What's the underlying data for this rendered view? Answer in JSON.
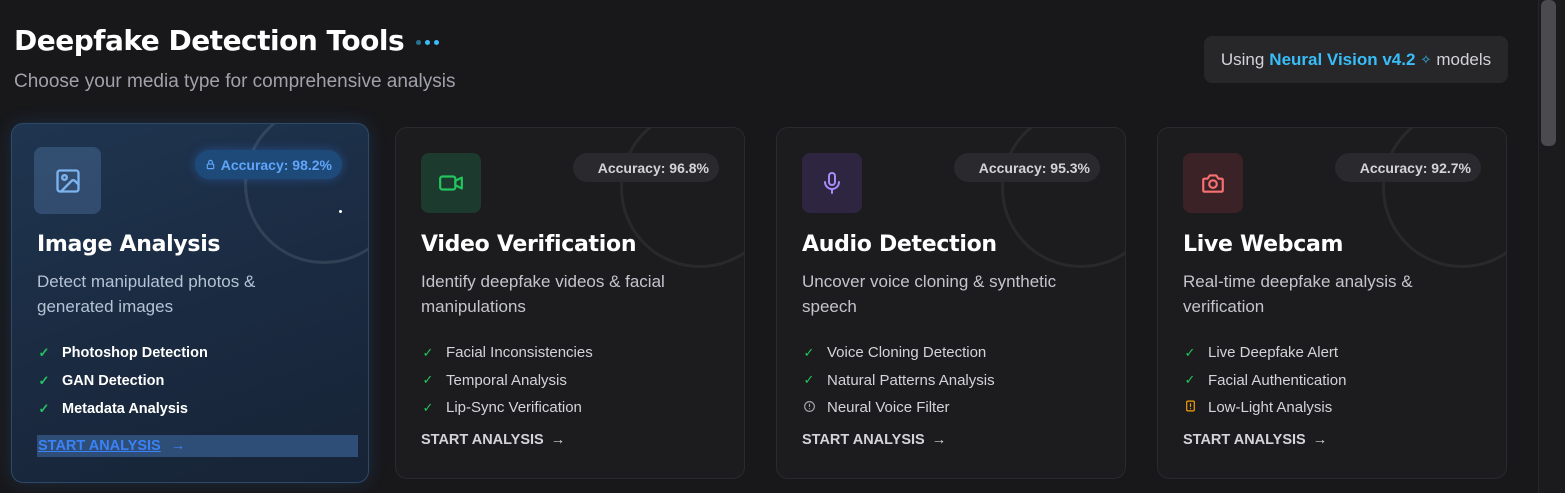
{
  "header": {
    "title": "Deepfake Detection Tools",
    "subtitle": "Choose your media type for comprehensive analysis"
  },
  "model_pill": {
    "prefix": "Using",
    "model_name": "Neural Vision v4.2",
    "suffix": "models",
    "sparkle_icon": "sparkle-icon"
  },
  "colors": {
    "accent": "#38bdf8",
    "success": "#22c55e",
    "warning": "#f59e0b",
    "active_card": "#1f3550"
  },
  "cards": [
    {
      "title": "Image Analysis",
      "description": "Detect manipulated photos & generated images",
      "accuracy": "Accuracy: 98.2%",
      "icon": "image-icon",
      "features": [
        "Photoshop Detection",
        "GAN Detection",
        "Metadata Analysis"
      ],
      "cta": "START ANALYSIS",
      "active": true
    },
    {
      "title": "Video Verification",
      "description": "Identify deepfake videos & facial manipulations",
      "accuracy": "Accuracy: 96.8%",
      "icon": "video-icon",
      "features": [
        "Facial Inconsistencies",
        "Temporal Analysis",
        "Lip-Sync Verification"
      ],
      "cta": "START ANALYSIS",
      "active": false
    },
    {
      "title": "Audio Detection",
      "description": "Uncover voice cloning & synthetic speech",
      "accuracy": "Accuracy: 95.3%",
      "icon": "microphone-icon",
      "features": [
        "Voice Cloning Detection",
        "Natural Patterns Analysis",
        "Neural Voice Filter"
      ],
      "cta": "START ANALYSIS",
      "active": false
    },
    {
      "title": "Live Webcam",
      "description": "Real-time deepfake analysis & verification",
      "accuracy": "Accuracy: 92.7%",
      "icon": "camera-icon",
      "features": [
        "Live Deepfake Alert",
        "Facial Authentication",
        "Low-Light Analysis"
      ],
      "cta": "START ANALYSIS",
      "active": false
    }
  ]
}
